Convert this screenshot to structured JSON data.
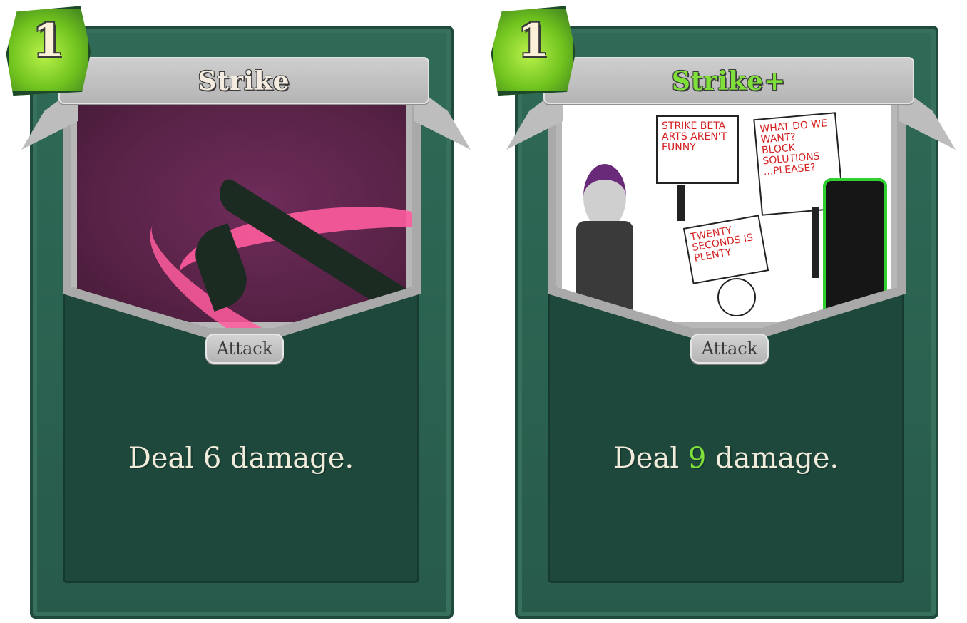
{
  "cards": [
    {
      "cost": "1",
      "title": "Strike",
      "type": "Attack",
      "description_prefix": "Deal ",
      "damage": "6",
      "description_suffix": " damage.",
      "upgraded": false
    },
    {
      "cost": "1",
      "title": "Strike+",
      "type": "Attack",
      "description_prefix": "Deal ",
      "damage": "9",
      "description_suffix": " damage.",
      "upgraded": true,
      "art_signs": {
        "sign1": "STRIKE BETA ARTS AREN'T FUNNY",
        "sign2": "WHAT DO WE WANT? BLOCK SOLUTIONS ...please?",
        "sign3": "TWENTY SECONDS IS PLENTY"
      }
    }
  ],
  "colors": {
    "card_green": "#2f6b57",
    "upgrade_green": "#7fe03a",
    "strike_pink": "#ff5c9e"
  }
}
